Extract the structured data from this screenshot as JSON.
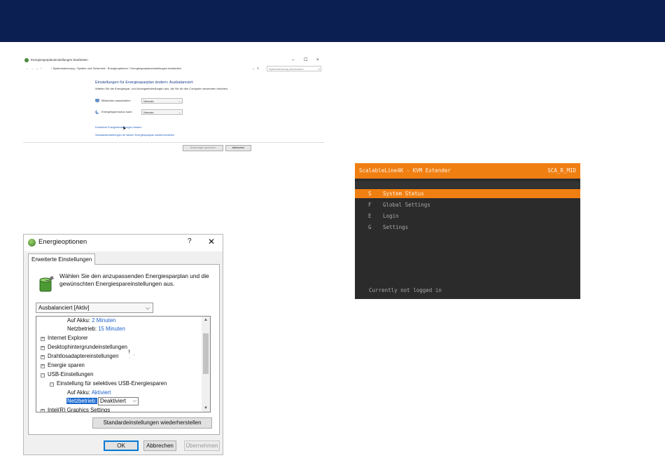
{
  "control_panel": {
    "window_title": "Energiesparplaneinstellungen bearbeiten",
    "controls": {
      "minimize": "–",
      "maximize": "☐",
      "close": "×"
    },
    "nav_arrows": "← → ⌄ ↑",
    "breadcrumb": "› Systemsteuerung › System und Sicherheit › Energieoptionen › Energiesparplaneinstellungen bearbeiten",
    "breadcrumb_chevron": "⌄",
    "refresh_glyph": "↻",
    "search_placeholder": "Systemsteuerung durchsuchen",
    "search_glyph": "⌕",
    "heading": "Einstellungen für Energiesparplan ändern: Ausbalanciert",
    "subtitle": "Wählen Sie die Energiespar- und Anzeigeeinstellungen aus, die Sie für den Computer verwenden möchten.",
    "rows": [
      {
        "label": "Bildschirm ausschalten:",
        "value": "Niemals"
      },
      {
        "label": "Energiesparmodus nach:",
        "value": "Niemals"
      }
    ],
    "links": {
      "advanced": "Erweiterte Energieeinstellungen ändern",
      "restore": "Standardeinstellungen für diesen Energiesparplan wiederherstellen"
    },
    "buttons": {
      "save": "Änderungen speichern",
      "cancel": "Abbrechen"
    }
  },
  "dialog": {
    "title": "Energieoptionen",
    "help": "?",
    "close": "✕",
    "tab": "Erweiterte Einstellungen",
    "description": "Wählen Sie den anzupassenden Energiesparplan und die gewünschten Energiespareinstellungen aus.",
    "plan": "Ausbalanciert [Aktiv]",
    "chevron": "⌵",
    "tree": {
      "on_battery_1_label": "Auf Akku:",
      "on_battery_1_value": "2 Minuten",
      "plugged_1_label": "Netzbetrieb:",
      "plugged_1_value": "15 Minuten",
      "items": [
        "Internet Explorer",
        "Desktophintergrundeinstellungen",
        "Drahtlosadaptereinstellungen",
        "Energie sparen",
        "USB-Einstellungen"
      ],
      "expand_plus": "+",
      "expand_minus": "−",
      "usb_child": "Einstellung für selektives USB-Energiesparen",
      "on_battery_2_label": "Auf Akku:",
      "on_battery_2_value": "Aktiviert",
      "plugged_2_label": "Netzbetrieb:",
      "plugged_2_value": "Deaktiviert",
      "next_item": "Intel(R) Graphics Settings"
    },
    "scroll_up": "▲",
    "scroll_down": "▼",
    "restore_button": "Standardeinstellungen wiederherstellen",
    "buttons": {
      "ok": "OK",
      "cancel": "Abbrechen",
      "apply": "Übernehmen"
    }
  },
  "kvm": {
    "title": "ScalableLine4K - KVM Extender",
    "device_id": "SCA_R_MID",
    "menu": [
      {
        "key": "S",
        "label": "System Status",
        "selected": true
      },
      {
        "key": "F",
        "label": "Global Settings",
        "selected": false
      },
      {
        "key": "E",
        "label": "Login",
        "selected": false
      },
      {
        "key": "G",
        "label": "Settings",
        "selected": false
      }
    ],
    "status": "Currently not logged in"
  },
  "colors": {
    "header_bar": "#0b1f52",
    "kvm_accent": "#f07f12",
    "kvm_background": "#2b2b2b",
    "link_blue": "#1f5fbf",
    "selection_blue": "#1b6ad1"
  }
}
